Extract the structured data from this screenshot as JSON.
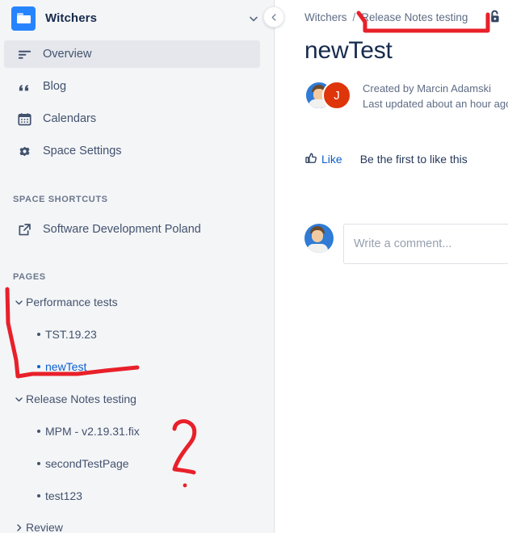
{
  "sidebar": {
    "space": {
      "name": "Witchers",
      "logo_icon": "folder-icon",
      "chevron_icon": "chevron-down-icon"
    },
    "nav_items": [
      {
        "label": "Overview",
        "icon": "overview-lines-icon",
        "active": true
      },
      {
        "label": "Blog",
        "icon": "quote-icon",
        "active": false
      },
      {
        "label": "Calendars",
        "icon": "calendar-icon",
        "active": false
      },
      {
        "label": "Space Settings",
        "icon": "gear-icon",
        "active": false
      }
    ],
    "shortcuts_heading": "SPACE SHORTCUTS",
    "shortcuts": [
      {
        "label": "Software Development Poland",
        "icon": "external-link-icon"
      }
    ],
    "pages_heading": "PAGES",
    "pages": [
      {
        "label": "Performance tests",
        "type": "parent",
        "expanded": true,
        "chevron": "chevron-down-icon",
        "selected": false
      },
      {
        "label": "TST.19.23",
        "type": "child",
        "selected": false
      },
      {
        "label": "newTest",
        "type": "child",
        "selected": true
      },
      {
        "label": "Release Notes testing",
        "type": "parent",
        "expanded": true,
        "chevron": "chevron-down-icon",
        "selected": false
      },
      {
        "label": "MPM - v2.19.31.fix",
        "type": "child",
        "selected": false
      },
      {
        "label": "secondTestPage",
        "type": "child",
        "selected": false
      },
      {
        "label": "test123",
        "type": "child",
        "selected": false
      },
      {
        "label": "Review",
        "type": "parent",
        "expanded": false,
        "chevron": "chevron-right-icon",
        "selected": false
      }
    ]
  },
  "content": {
    "collapse_button_icon": "chevron-left-icon",
    "breadcrumb": {
      "items": [
        "Witchers",
        "Release Notes testing"
      ],
      "separator": "/"
    },
    "restrictions_icon": "unlock-icon",
    "title": "newTest",
    "byline": {
      "created": "Created by Marcin Adamski",
      "updated": "Last updated about an hour ago b",
      "avatar_initial": "J"
    },
    "like": {
      "icon": "thumbs-up-icon",
      "label": "Like",
      "hint": "Be the first to like this"
    },
    "comment": {
      "placeholder": "Write a comment..."
    }
  },
  "colors": {
    "sidebar_bg": "#f4f5f7",
    "active_row": "#e5e7ec",
    "text": "#42526e",
    "heading": "#172b4d",
    "link": "#0b5fce",
    "annotation_red": "#e8202a",
    "avatar_red": "#de350b",
    "logo_blue": "#2684ff"
  },
  "annotations": {
    "color": "#e8202a",
    "marks": [
      "breadcrumb-underline-bracket",
      "sidebar-newtest-bracket",
      "handwritten-2"
    ]
  }
}
